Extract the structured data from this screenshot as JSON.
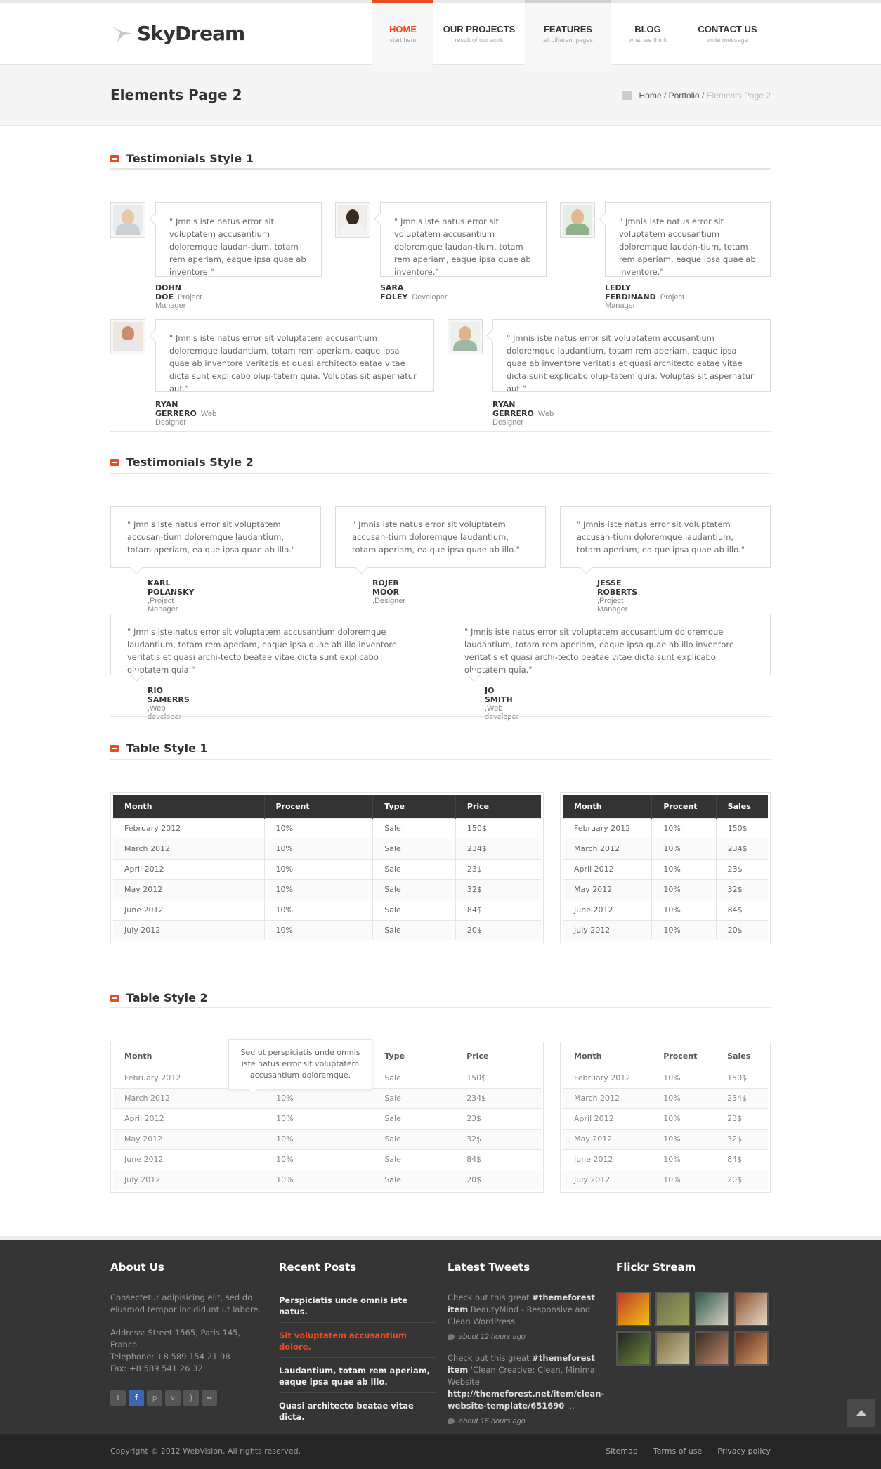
{
  "brand": {
    "name": "SkyDream"
  },
  "nav": [
    {
      "label": "HOME",
      "sub": "start here",
      "active": true
    },
    {
      "label": "OUR PROJECTS",
      "sub": "result of our work"
    },
    {
      "label": "FEATURES",
      "sub": "all different pages"
    },
    {
      "label": "BLOG",
      "sub": "what we think"
    },
    {
      "label": "CONTACT US",
      "sub": "write message"
    }
  ],
  "page": {
    "title": "Elements Page 2",
    "breadcrumb": {
      "home": "Home",
      "sep1": " / ",
      "portfolio": "Portfolio",
      "sep2": " / ",
      "current": "Elements Page 2"
    }
  },
  "sections": {
    "testimonials1": "Testimonials Style 1",
    "testimonials2": "Testimonials Style 2",
    "table1": "Table Style 1",
    "table2": "Table Style 2"
  },
  "testimonials1": {
    "short_quote": "\" Jmnis iste natus error sit voluptatem accusantium doloremque laudan-tium, totam rem aperiam, eaque ipsa quae ab inventore.\"",
    "long_quote": "\" Jmnis iste natus error sit voluptatem accusantium doloremque laudantium, totam rem aperiam, eaque ipsa quae ab inventore veritatis et quasi architecto eatae vitae dicta sunt explicabo olup-tatem quia. Voluptas sit aspernatur aut.\"",
    "people": [
      {
        "name": "DOHN DOE",
        "role": "Project Manager"
      },
      {
        "name": "SARA FOLEY",
        "role": "Developer"
      },
      {
        "name": "LEDLY FERDINAND",
        "role": "Project Manager"
      },
      {
        "name": "RYAN GERRERO",
        "role": "Web Designer"
      },
      {
        "name": "RYAN GERRERO",
        "role": "Web Designer"
      }
    ]
  },
  "testimonials2": {
    "short_quote": "\" Jmnis iste natus error sit voluptatem accusan-tium doloremque laudantium, totam aperiam, ea que ipsa quae ab illo.\"",
    "long_quote": "\" Jmnis iste natus error sit voluptatem accusantium doloremque laudantium, totam rem aperiam, eaque ipsa quae ab illo inventore veritatis et quasi archi-tecto beatae vitae dicta sunt explicabo oluptatem quia.\"",
    "people": [
      {
        "name": "KARL POLANSKY",
        "role": " ,Project Manager"
      },
      {
        "name": "ROJER MOOR",
        "role": " ,Designer"
      },
      {
        "name": "JESSE ROBERTS",
        "role": " ,Project Manager"
      },
      {
        "name": "RIO SAMERRS",
        "role": " ,Web developer"
      },
      {
        "name": "JO SMITH",
        "role": " ,Web developer"
      }
    ]
  },
  "table_wide": {
    "headers": [
      "Month",
      "Procent",
      "Type",
      "Price"
    ],
    "rows": [
      [
        "February 2012",
        "10%",
        "Sale",
        "150$"
      ],
      [
        "March 2012",
        "10%",
        "Sale",
        "234$"
      ],
      [
        "April 2012",
        "10%",
        "Sale",
        "23$"
      ],
      [
        "May 2012",
        "10%",
        "Sale",
        "32$"
      ],
      [
        "June 2012",
        "10%",
        "Sale",
        "84$"
      ],
      [
        "July 2012",
        "10%",
        "Sale",
        "20$"
      ]
    ]
  },
  "table_narrow": {
    "headers": [
      "Month",
      "Procent",
      "Sales"
    ],
    "rows": [
      [
        "February 2012",
        "10%",
        "150$"
      ],
      [
        "March 2012",
        "10%",
        "234$"
      ],
      [
        "April 2012",
        "10%",
        "23$"
      ],
      [
        "May 2012",
        "10%",
        "32$"
      ],
      [
        "June 2012",
        "10%",
        "84$"
      ],
      [
        "July 2012",
        "10%",
        "20$"
      ]
    ]
  },
  "tooltip": "Sed ut perspiciatis unde omnis iste natus error sit voluptatem accusantium doloremque.",
  "footer": {
    "about": {
      "title": "About Us",
      "text": "Consectetur adipisicing elit, sed do eiusmod tempor incididunt ut labore.",
      "address": "Address: Street 1565, Paris 145, France",
      "phone": "Telephone: +8 589 154 21 98",
      "fax": "Fax: +8 589 541 26 32"
    },
    "posts": {
      "title": "Recent Posts",
      "items": [
        "Perspiciatis unde omnis iste natus.",
        "Sit voluptatem accusantium dolore.",
        "Laudantium, totam rem aperiam, eaque ipsa quae ab illo.",
        "Quasi architecto beatae vitae dicta."
      ]
    },
    "tweets": {
      "title": "Latest Tweets",
      "items": [
        {
          "pre": "Check out this great ",
          "tag": "#themeforest item",
          "post": " BeautyMind - Responsive and Clean WordPress",
          "time": "about 12 hours ago"
        },
        {
          "pre": "Check out this great ",
          "tag": "#themeforest item",
          "post": " 'Clean Creative: Clean, Minimal Website ",
          "link": "http://themeforest.net/item/clean-website-template/651690",
          "tail": " ...",
          "time": "about 16 hours ago"
        }
      ]
    },
    "flickr": {
      "title": "Flickr Stream"
    },
    "copyright": "Copyright © 2012 WebVision. All rights reserved.",
    "links": [
      "Sitemap",
      "Terms of use",
      "Privacy policy"
    ]
  },
  "colors": {
    "accent": "#e84c1f",
    "dark": "#333333",
    "footer": "#353535"
  }
}
